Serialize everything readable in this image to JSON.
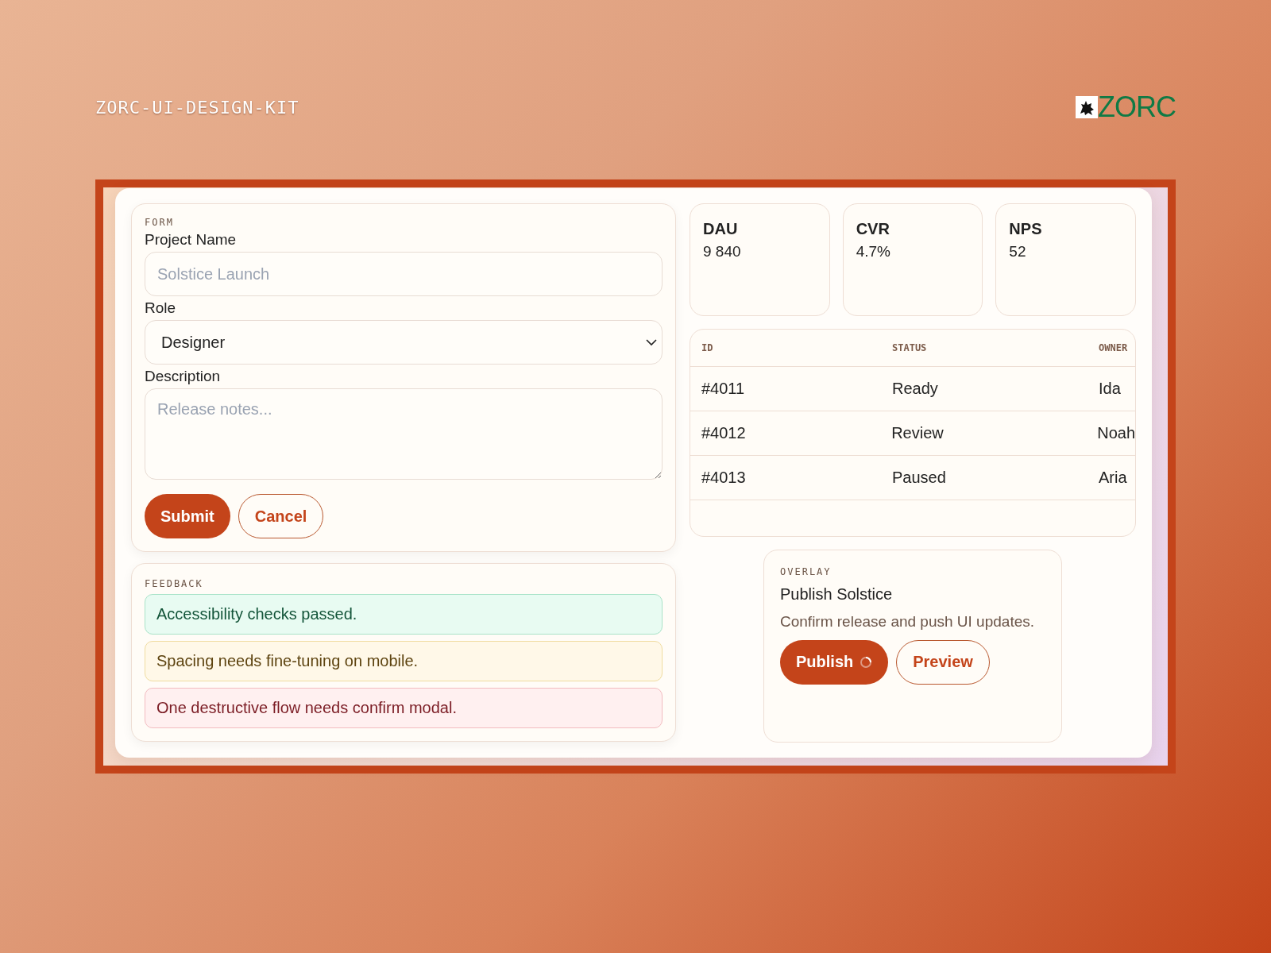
{
  "header": {
    "title": "ZORC-UI-DESIGN-KIT",
    "logo_text": "ZORC"
  },
  "form": {
    "section_label": "FORM",
    "fields": [
      {
        "kind": "text",
        "label": "Project Name",
        "placeholder": "Solstice Launch"
      },
      {
        "kind": "select",
        "label": "Role",
        "value": "Designer"
      },
      {
        "kind": "textarea",
        "label": "Description",
        "placeholder": "Release notes..."
      }
    ],
    "buttons": [
      {
        "kind": "primary",
        "label": "Submit"
      },
      {
        "kind": "secondary",
        "label": "Cancel"
      }
    ]
  },
  "feedback": {
    "section_label": "FEEDBACK",
    "messages": [
      {
        "kind": "success",
        "text": "Accessibility checks passed."
      },
      {
        "kind": "warning",
        "text": "Spacing needs fine-tuning on mobile."
      },
      {
        "kind": "error",
        "text": "One destructive flow needs confirm modal."
      }
    ]
  },
  "metrics": [
    {
      "label": "DAU",
      "value": "9 840"
    },
    {
      "label": "CVR",
      "value": "4.7%"
    },
    {
      "label": "NPS",
      "value": "52"
    }
  ],
  "table": {
    "columns": [
      "ID",
      "STATUS",
      "OWNER"
    ],
    "rows": [
      [
        "#4011",
        "Ready",
        "Ida"
      ],
      [
        "#4012",
        "Review",
        "Noah"
      ],
      [
        "#4013",
        "Paused",
        "Aria"
      ]
    ]
  },
  "overlay": {
    "section_label": "OVERLAY",
    "title": "Publish Solstice",
    "text": "Confirm release and push UI updates.",
    "buttons": [
      {
        "kind": "primary",
        "label": "Publish",
        "loading": true
      },
      {
        "kind": "secondary",
        "label": "Preview",
        "loading": false
      }
    ]
  }
}
